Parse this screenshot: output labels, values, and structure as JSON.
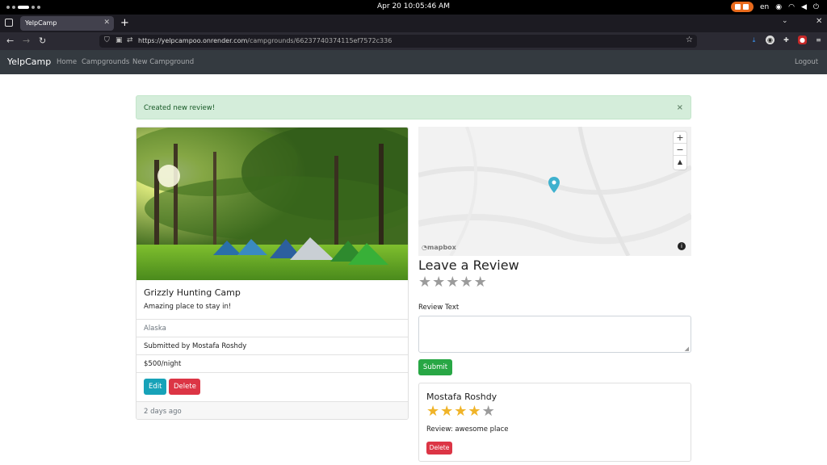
{
  "os": {
    "clock": "Apr 20  10:05:46 AM",
    "lang": "en"
  },
  "browser": {
    "tab_title": "YelpCamp",
    "url_host": "https://yelpcampoo.onrender.com",
    "url_path": "/campgrounds/66237740374115ef7572c336"
  },
  "nav": {
    "brand": "YelpCamp",
    "links": [
      "Home",
      "Campgrounds",
      "New Campground"
    ],
    "logout": "Logout"
  },
  "alert": {
    "message": "Created new review!",
    "close": "×"
  },
  "campground": {
    "title": "Grizzly Hunting Camp",
    "description": "Amazing place to stay in!",
    "location": "Alaska",
    "submitted_by": "Submitted by Mostafa Roshdy",
    "price": "$500/night",
    "edit_label": "Edit",
    "delete_label": "Delete",
    "posted": "2 days ago"
  },
  "map": {
    "attribution": "mapbox",
    "zoom_in": "+",
    "zoom_out": "−",
    "compass": "▲",
    "info": "i"
  },
  "review_form": {
    "heading": "Leave a Review",
    "rating": 0,
    "max_rating": 5,
    "text_label": "Review Text",
    "submit_label": "Submit"
  },
  "reviews": [
    {
      "author": "Mostafa Roshdy",
      "rating": 4,
      "body": "Review: awesome place",
      "delete_label": "Delete"
    }
  ],
  "colors": {
    "star_filled": "#f0b429",
    "star_empty": "#9b9b9b",
    "success": "#28a745",
    "danger": "#dc3545",
    "info": "#17a2b8"
  }
}
